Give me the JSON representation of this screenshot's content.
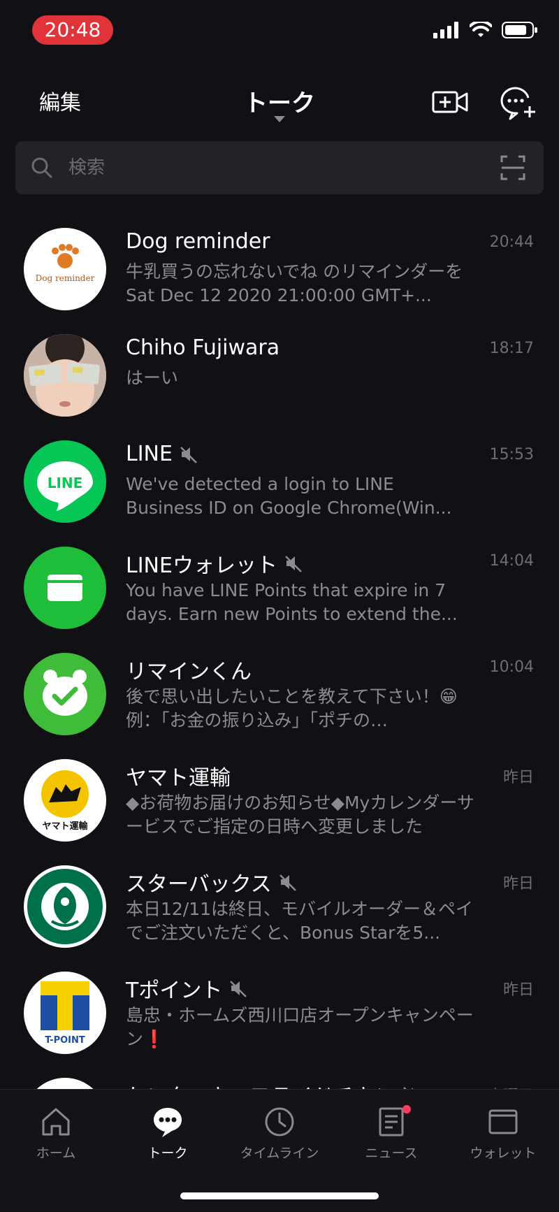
{
  "status_bar": {
    "time": "20:48"
  },
  "header": {
    "edit_label": "編集",
    "title": "トーク"
  },
  "search": {
    "placeholder": "検索"
  },
  "chats": [
    {
      "name": "Dog reminder",
      "time": "20:44",
      "preview": "牛乳買うの忘れないでね のリマインダーを Sat Dec 12 2020 21:00:00 GMT+...",
      "muted": false,
      "avatar": "dog-reminder",
      "avatar_text": "Dog reminder"
    },
    {
      "name": "Chiho Fujiwara",
      "time": "18:17",
      "preview": "はーい",
      "muted": false,
      "avatar": "photo"
    },
    {
      "name": "LINE",
      "time": "15:53",
      "preview": "We've detected a login to LINE Business ID on Google Chrome(Win...",
      "muted": true,
      "avatar": "line",
      "avatar_text": "LINE"
    },
    {
      "name": "LINEウォレット",
      "time": "14:04",
      "preview": "You have LINE Points that expire in 7 days. Earn new Points to extend the...",
      "muted": true,
      "avatar": "wallet"
    },
    {
      "name": "リマインくん",
      "time": "10:04",
      "preview": "後で思い出したいことを教えて下さい！😁　例：「お金の振り込み」「ポチの…",
      "muted": false,
      "avatar": "remind"
    },
    {
      "name": "ヤマト運輸",
      "time": "昨日",
      "preview": "◆お荷物お届けのお知らせ◆Myカレンダーサービスでご指定の日時へ変更しました",
      "muted": false,
      "avatar": "yamato",
      "avatar_text": "ヤマト運輸"
    },
    {
      "name": "スターバックス",
      "time": "昨日",
      "preview": "本日12/11は終日、モバイルオーダー＆ペイでご注文いただくと、Bonus Starを5...",
      "muted": true,
      "avatar": "starbucks"
    },
    {
      "name": "Tポイント",
      "time": "昨日",
      "preview": "島忠・ホームズ西川口店オープンキャンペーン❗",
      "muted": true,
      "avatar": "tpoint",
      "avatar_text": "T-POINT"
    },
    {
      "name": "ケンタッキーフライドチキン",
      "time": "木曜日",
      "preview": "",
      "muted": true,
      "avatar": "kfc"
    }
  ],
  "tabs": [
    {
      "label": "ホーム",
      "icon": "home-icon"
    },
    {
      "label": "トーク",
      "icon": "talk-icon"
    },
    {
      "label": "タイムライン",
      "icon": "clock-icon"
    },
    {
      "label": "ニュース",
      "icon": "news-icon"
    },
    {
      "label": "ウォレット",
      "icon": "wallet-icon"
    }
  ],
  "colors": {
    "background": "#111014",
    "line_green": "#06c755",
    "time_pill": "#e0333a",
    "badge": "#ff3b5c"
  }
}
